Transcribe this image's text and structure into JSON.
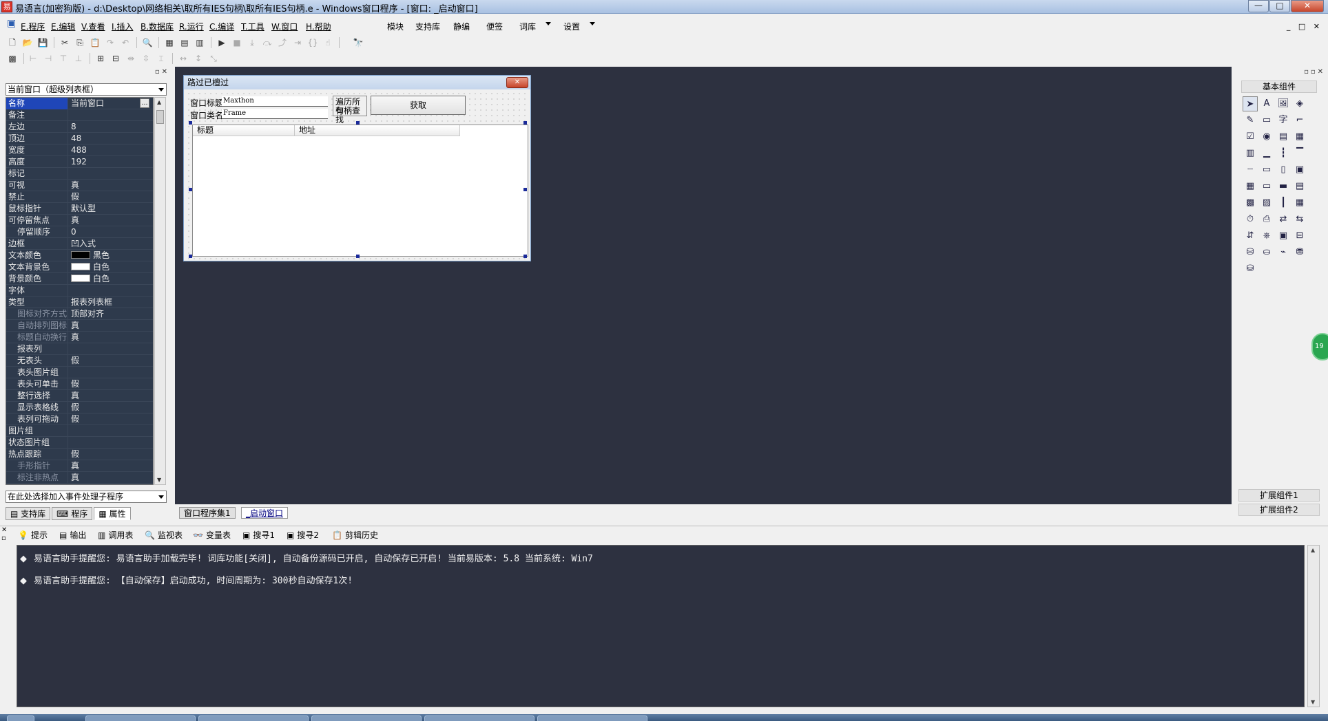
{
  "window": {
    "title": "易语言(加密狗版) - d:\\Desktop\\网络相关\\取所有IES句柄\\取所有IES句柄.e - Windows窗口程序 - [窗口: _启动窗口]",
    "icon": "app-logo-icon",
    "buttons": {
      "minimize": "—",
      "maximize": "□",
      "close": "✕"
    }
  },
  "menu": {
    "items": [
      "E.程序",
      "E.编辑",
      "V.查看",
      "I.插入",
      "B.数据库",
      "R.运行",
      "C.编译",
      "T.工具",
      "W.窗口",
      "H.帮助"
    ],
    "extra": [
      "模块",
      "支持库",
      "静编",
      "便签",
      "词库",
      "设置"
    ],
    "doc_controls": "_ □ ✕"
  },
  "left_panel": {
    "object_select": "当前窗口（超级列表框）",
    "properties": [
      {
        "name": "名称",
        "value": "当前窗口"
      },
      {
        "name": "备注",
        "value": ""
      },
      {
        "name": "左边",
        "value": "8"
      },
      {
        "name": "顶边",
        "value": "48"
      },
      {
        "name": "宽度",
        "value": "488"
      },
      {
        "name": "高度",
        "value": "192"
      },
      {
        "name": "标记",
        "value": ""
      },
      {
        "name": "可视",
        "value": "真"
      },
      {
        "name": "禁止",
        "value": "假"
      },
      {
        "name": "鼠标指针",
        "value": "默认型"
      },
      {
        "name": "可停留焦点",
        "value": "真"
      },
      {
        "name": "停留顺序",
        "value": "0"
      },
      {
        "name": "边框",
        "value": "凹入式"
      },
      {
        "name": "文本颜色",
        "value": "黑色"
      },
      {
        "name": "文本背景色",
        "value": "白色"
      },
      {
        "name": "背景颜色",
        "value": "白色"
      },
      {
        "name": "字体",
        "value": ""
      },
      {
        "name": "类型",
        "value": "报表列表框"
      },
      {
        "name": "图标对齐方式",
        "value": "顶部对齐"
      },
      {
        "name": "自动排列图标",
        "value": "真"
      },
      {
        "name": "标题自动换行",
        "value": "真"
      },
      {
        "name": "报表列",
        "value": ""
      },
      {
        "name": "无表头",
        "value": "假"
      },
      {
        "name": "表头图片组",
        "value": ""
      },
      {
        "name": "表头可单击",
        "value": "假"
      },
      {
        "name": "整行选择",
        "value": "真"
      },
      {
        "name": "显示表格线",
        "value": "假"
      },
      {
        "name": "表列可拖动",
        "value": "假"
      },
      {
        "name": "图片组",
        "value": ""
      },
      {
        "name": "状态图片组",
        "value": ""
      },
      {
        "name": "热点跟踪",
        "value": "假"
      },
      {
        "name": "手形指针",
        "value": "真"
      },
      {
        "name": "标注非热点",
        "value": "真"
      }
    ],
    "colors": {
      "text": "#000000",
      "text_bg": "#ffffff",
      "bg": "#ffffff"
    },
    "event_select": "在此处选择加入事件处理子程序",
    "tabs": [
      "支持库",
      "程序",
      "属性"
    ]
  },
  "form": {
    "title": "路过已檀过",
    "window_title_label": "窗口标题:",
    "window_title_value": "Maxthon",
    "window_class_label": "窗口类名:",
    "window_class_value": "Frame",
    "checkbox_label_1": "遍历所有",
    "checkbox_label_2": "句柄查找",
    "get_button": "获取",
    "columns": [
      "标题",
      "地址"
    ]
  },
  "toolbox": {
    "title": "基本组件",
    "ext1": "扩展组件1",
    "ext2": "扩展组件2",
    "badge": "19"
  },
  "design_tabs": [
    "窗口程序集1",
    "_启动窗口"
  ],
  "output_tabs": [
    "提示",
    "输出",
    "调用表",
    "监视表",
    "变量表",
    "搜寻1",
    "搜寻2",
    "剪辑历史"
  ],
  "output_lines": [
    "易语言助手提醒您:  易语言助手加载完毕!  词库功能[关闭], 自动备份源码已开启, 自动保存已开启!  当前易版本: 5.8  当前系统: Win7",
    "易语言助手提醒您: 【自动保存】启动成功, 时间周期为: 300秒自动保存1次!"
  ]
}
